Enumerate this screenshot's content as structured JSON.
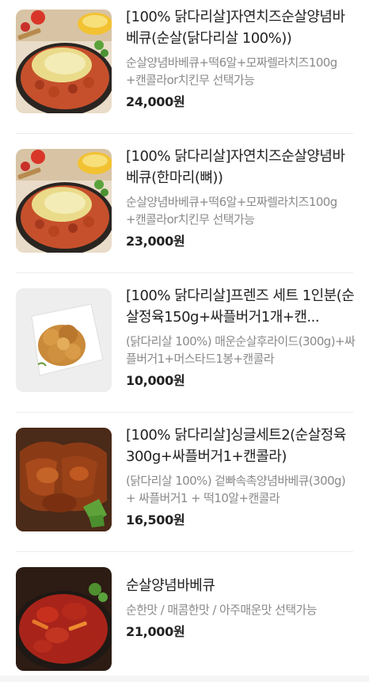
{
  "menu_items": [
    {
      "title": "[100% 닭다리살]자연치즈순살양념바베큐(순살(닭다리살 100%))",
      "description": "순살양념바베큐+떡6알+모짜렐라치즈100g+캔콜라or치킨무 선택가능",
      "price": "24,000원",
      "image_icon": "cheese-chicken-image"
    },
    {
      "title": "[100% 닭다리살]자연치즈순살양념바베큐(한마리(뼈))",
      "description": "순살양념바베큐+떡6알+모짜렐라치즈100g+캔콜라or치킨무 선택가능",
      "price": "23,000원",
      "image_icon": "cheese-chicken-image"
    },
    {
      "title": "[100% 닭다리살]프렌즈 세트 1인분(순살정육150g+싸플버거1개+캔...",
      "description": "(닭다리살 100%) 매운순살후라이드(300g)+싸플버거1+머스타드1봉+캔콜라",
      "price": "10,000원",
      "image_icon": "fried-chicken-image"
    },
    {
      "title": "[100% 닭다리살]싱글세트2(순살정육300g+싸플버거1+캔콜라)",
      "description": "(닭다리살 100%) 겉빠속촉양념바베큐(300g) + 싸플버거1 + 떡10알+캔콜라",
      "price": "16,500원",
      "image_icon": "bbq-chicken-image"
    },
    {
      "title": "순살양념바베큐",
      "description": "순한맛 / 매콤한맛 / 아주매운맛 선택가능",
      "price": "21,000원",
      "image_icon": "spicy-bbq-image"
    }
  ],
  "colors": {
    "title": "#222222",
    "description": "#8a8a8a",
    "price": "#222222",
    "divider": "#ececec"
  }
}
